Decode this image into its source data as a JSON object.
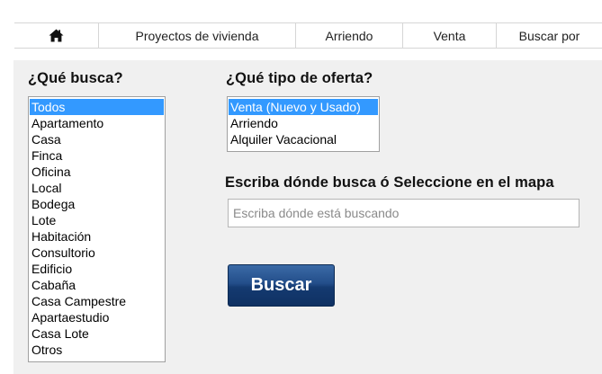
{
  "nav": {
    "home_icon": "home-icon",
    "items": [
      "Proyectos de vivienda",
      "Arriendo",
      "Venta",
      "Buscar por"
    ]
  },
  "property_type": {
    "title": "¿Qué busca?",
    "selected": "Todos",
    "options": [
      "Todos",
      "Apartamento",
      "Casa",
      "Finca",
      "Oficina",
      "Local",
      "Bodega",
      "Lote",
      "Habitación",
      "Consultorio",
      "Edificio",
      "Cabaña",
      "Casa Campestre",
      "Apartaestudio",
      "Casa Lote",
      "Otros"
    ]
  },
  "offer_type": {
    "title": "¿Qué tipo de oferta?",
    "selected": "Venta (Nuevo y Usado)",
    "options": [
      "Venta (Nuevo y Usado)",
      "Arriendo",
      "Alquiler Vacacional"
    ]
  },
  "location": {
    "title": "Escriba dónde busca ó Seleccione en el mapa",
    "placeholder": "Escriba dónde está buscando",
    "value": ""
  },
  "search_button": {
    "label": "Buscar"
  },
  "colors": {
    "selection": "#3399ff",
    "button": "#1a3f78",
    "panel_bg": "#f0f0f0"
  }
}
